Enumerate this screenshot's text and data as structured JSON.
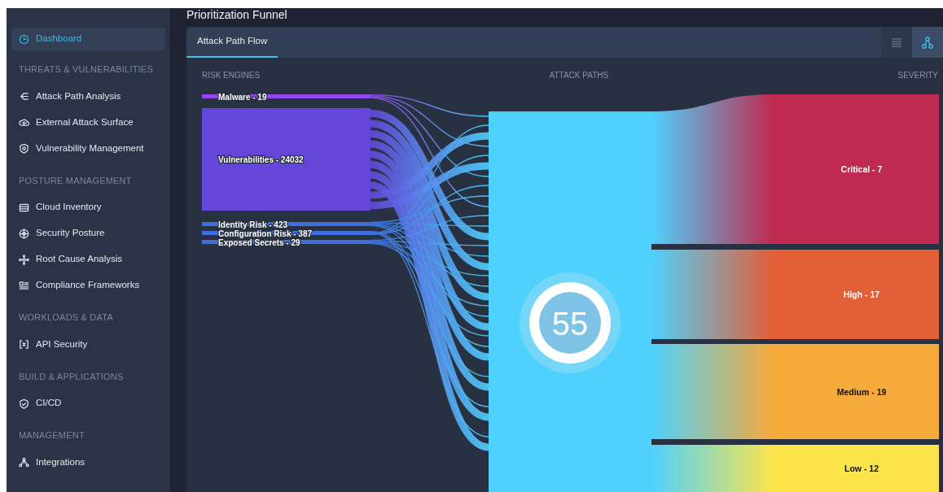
{
  "page_title": "Prioritization Funnel",
  "sidebar": {
    "sections": [
      {
        "items": [
          {
            "label": "Dashboard",
            "selected": true
          }
        ]
      },
      {
        "heading": "THREATS & VULNERABILITIES",
        "items": [
          {
            "label": "Attack Path Analysis",
            "selected": false
          },
          {
            "label": "External Attack Surface",
            "selected": false
          },
          {
            "label": "Vulnerability Management",
            "selected": false
          }
        ]
      },
      {
        "heading": "POSTURE MANAGEMENT",
        "items": [
          {
            "label": "Cloud Inventory",
            "selected": false
          },
          {
            "label": "Security Posture",
            "selected": false
          },
          {
            "label": "Root Cause Analysis",
            "selected": false
          },
          {
            "label": "Compliance Frameworks",
            "selected": false
          }
        ]
      },
      {
        "heading": "WORKLOADS & DATA",
        "items": [
          {
            "label": "API Security",
            "selected": false
          }
        ]
      },
      {
        "heading": "BUILD & APPLICATIONS",
        "items": [
          {
            "label": "CI/CD",
            "selected": false
          }
        ]
      },
      {
        "heading": "MANAGEMENT",
        "items": [
          {
            "label": "Integrations",
            "selected": false
          }
        ]
      }
    ]
  },
  "card": {
    "tabs": [
      {
        "label": "Attack Path Flow",
        "selected": true
      }
    ],
    "view_buttons": [
      {
        "kind": "list",
        "selected": false
      },
      {
        "kind": "diagram",
        "selected": true
      }
    ],
    "column_headings": [
      "RISK ENGINES",
      "ATTACK PATHS",
      "SEVERITY"
    ],
    "sources": [
      {
        "label": "Malware - 19",
        "color": "#9347ee"
      },
      {
        "label": "Vulnerabilities - 24032",
        "color": "#6447da"
      },
      {
        "label": "Identity Risk - 423",
        "color": "#3f6fde"
      },
      {
        "label": "Configuration Risk - 387",
        "color": "#3f6fde"
      },
      {
        "label": "Exposed Secrets - 29",
        "color": "#3f6fde"
      }
    ],
    "attack_paths": {
      "count": "55",
      "color": "#4fd1fd"
    },
    "severities": [
      {
        "label": "Critical - 7",
        "color": "#bf2a50"
      },
      {
        "label": "High - 17",
        "color": "#e35f37"
      },
      {
        "label": "Medium - 19",
        "color": "#f6aa3a"
      },
      {
        "label": "Low - 12",
        "color": "#fce54b"
      }
    ]
  }
}
